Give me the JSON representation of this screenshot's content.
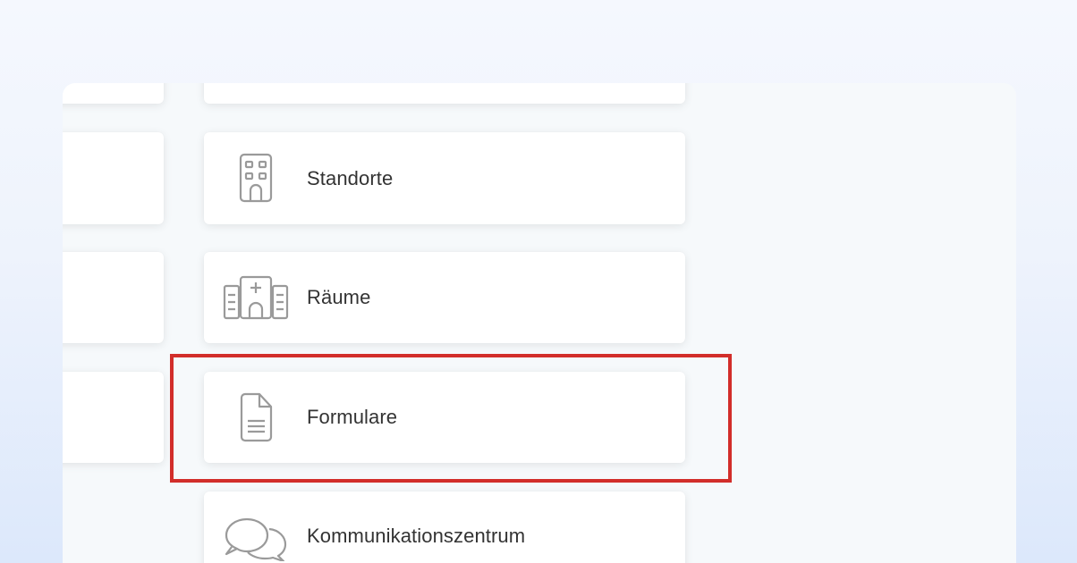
{
  "menu": {
    "items": [
      {
        "label": "",
        "icon": "unknown-icon"
      },
      {
        "label": "Standorte",
        "icon": "building-icon"
      },
      {
        "label": "Räume",
        "icon": "hospital-icon"
      },
      {
        "label": "Formulare",
        "icon": "document-icon"
      },
      {
        "label": "Kommunikationszentrum",
        "icon": "chat-bubbles-icon"
      }
    ]
  },
  "highlight": {
    "target": "Formulare",
    "color": "#d22e2a"
  },
  "colors": {
    "card_background": "#ffffff",
    "panel_background": "#f6f9fb",
    "icon_stroke": "#9a9a9a",
    "label_text": "#333333"
  }
}
